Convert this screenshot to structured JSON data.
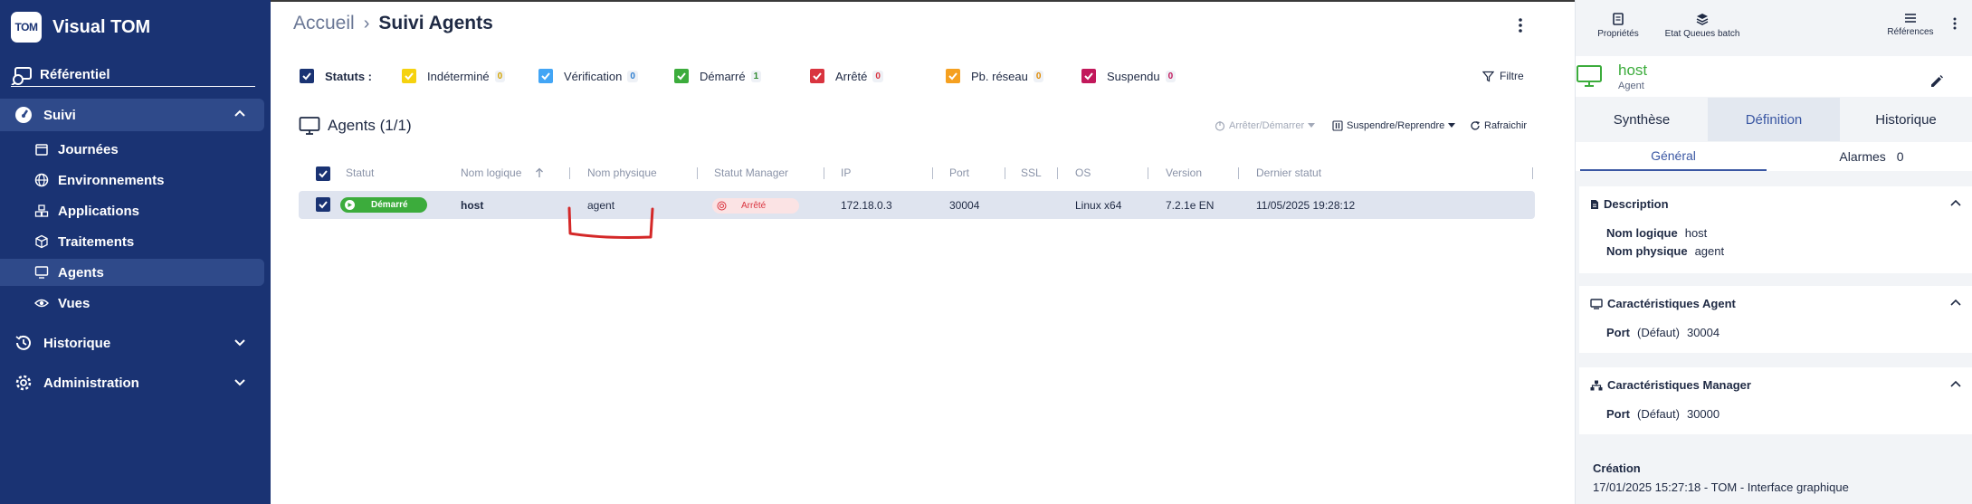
{
  "sidebar": {
    "logo_text": "TOM",
    "app_name": "Visual TOM",
    "referentiel": "Référentiel",
    "suivi": "Suivi",
    "suivi_items": [
      {
        "label": "Journées"
      },
      {
        "label": "Environnements"
      },
      {
        "label": "Applications"
      },
      {
        "label": "Traitements"
      },
      {
        "label": "Agents"
      },
      {
        "label": "Vues"
      }
    ],
    "historique": "Historique",
    "administration": "Administration"
  },
  "breadcrumb": {
    "home": "Accueil",
    "current": "Suivi Agents"
  },
  "statuses": {
    "label": "Statuts :",
    "items": [
      {
        "label": "Indéterminé",
        "count": "0",
        "color": "#f5d20f"
      },
      {
        "label": "Vérification",
        "count": "0",
        "color": "#42a5f5"
      },
      {
        "label": "Démarré",
        "count": "1",
        "color": "#3cac3c"
      },
      {
        "label": "Arrêté",
        "count": "0",
        "color": "#d9343f"
      },
      {
        "label": "Pb. réseau",
        "count": "0",
        "color": "#f5a020"
      },
      {
        "label": "Suspendu",
        "count": "0",
        "color": "#c2185b"
      }
    ],
    "filter": "Filtre"
  },
  "agents": {
    "title": "Agents (1/1)",
    "actions": {
      "start_stop": "Arrêter/Démarrer",
      "suspend_resume": "Suspendre/Reprendre",
      "refresh": "Rafraichir"
    },
    "columns": [
      "Statut",
      "Nom logique",
      "Nom physique",
      "Statut Manager",
      "IP",
      "Port",
      "SSL",
      "OS",
      "Version",
      "Dernier statut"
    ],
    "rows": [
      {
        "status": "Démarré",
        "logical_name": "host",
        "physical_name": "agent",
        "manager_status": "Arrêté",
        "ip": "172.18.0.3",
        "port": "30004",
        "ssl": "",
        "os": "Linux x64",
        "version": "7.2.1e EN",
        "last_status": "11/05/2025 19:28:12"
      }
    ]
  },
  "panel": {
    "tools": {
      "properties": "Propriétés",
      "queues": "Etat Queues batch",
      "references": "Références"
    },
    "host_name": "host",
    "host_type": "Agent",
    "tabs": [
      "Synthèse",
      "Définition",
      "Historique"
    ],
    "subtabs": {
      "general": "Général",
      "alarms": "Alarmes",
      "alarms_count": "0"
    },
    "description": {
      "title": "Description",
      "logical_label": "Nom logique",
      "logical_value": "host",
      "physical_label": "Nom physique",
      "physical_value": "agent"
    },
    "agent_char": {
      "title": "Caractéristiques Agent",
      "port_label": "Port",
      "default_label": "(Défaut)",
      "port_value": "30004"
    },
    "manager_char": {
      "title": "Caractéristiques Manager",
      "port_label": "Port",
      "default_label": "(Défaut)",
      "port_value": "30000"
    },
    "creation": {
      "title": "Création",
      "value": "17/01/2025 15:27:18 - TOM - Interface graphique"
    }
  }
}
